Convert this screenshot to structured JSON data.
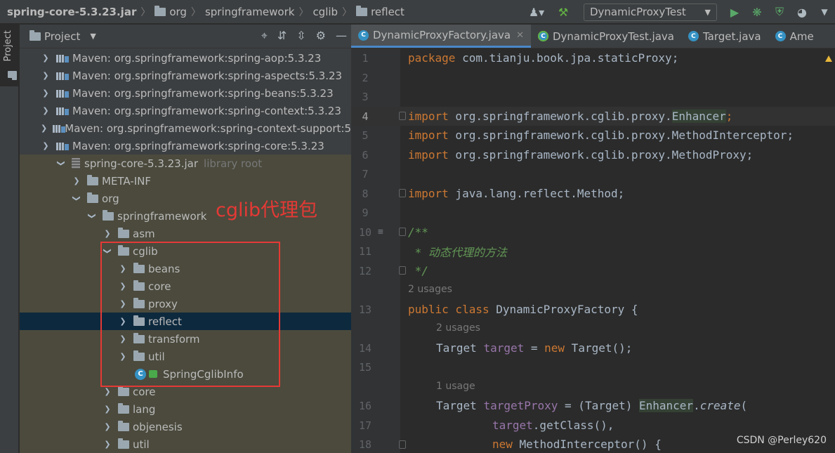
{
  "breadcrumb": {
    "items": [
      "spring-core-5.3.23.jar",
      "org",
      "springframework",
      "cglib",
      "reflect"
    ]
  },
  "toolbar": {
    "run_config": "DynamicProxyTest"
  },
  "stripe": {
    "project_label": "Project"
  },
  "project_panel": {
    "title": "Project",
    "tree": [
      {
        "label": "Maven: org.springframework:spring-aop:5.3.23",
        "type": "lib",
        "expanded": false
      },
      {
        "label": "Maven: org.springframework:spring-aspects:5.3.23",
        "type": "lib",
        "expanded": false
      },
      {
        "label": "Maven: org.springframework:spring-beans:5.3.23",
        "type": "lib",
        "expanded": false
      },
      {
        "label": "Maven: org.springframework:spring-context:5.3.23",
        "type": "lib",
        "expanded": false
      },
      {
        "label": "Maven: org.springframework:spring-context-support:5",
        "type": "lib",
        "expanded": false
      },
      {
        "label": "Maven: org.springframework:spring-core:5.3.23",
        "type": "lib",
        "expanded": true
      },
      {
        "label": "spring-core-5.3.23.jar",
        "suffix": "library root",
        "type": "jar",
        "expanded": true
      },
      {
        "label": "META-INF",
        "type": "folder",
        "expanded": false
      },
      {
        "label": "org",
        "type": "folder",
        "expanded": true
      },
      {
        "label": "springframework",
        "type": "folder",
        "expanded": true
      },
      {
        "label": "asm",
        "type": "folder",
        "expanded": false
      },
      {
        "label": "cglib",
        "type": "folder",
        "expanded": true
      },
      {
        "label": "beans",
        "type": "folder",
        "expanded": false
      },
      {
        "label": "core",
        "type": "folder",
        "expanded": false
      },
      {
        "label": "proxy",
        "type": "folder",
        "expanded": false
      },
      {
        "label": "reflect",
        "type": "folder",
        "expanded": false,
        "selected": true
      },
      {
        "label": "transform",
        "type": "folder",
        "expanded": false
      },
      {
        "label": "util",
        "type": "folder",
        "expanded": false
      },
      {
        "label": "SpringCglibInfo",
        "type": "class"
      },
      {
        "label": "core",
        "type": "folder",
        "expanded": false
      },
      {
        "label": "lang",
        "type": "folder",
        "expanded": false
      },
      {
        "label": "objenesis",
        "type": "folder",
        "expanded": false
      },
      {
        "label": "util",
        "type": "folder",
        "expanded": false
      }
    ]
  },
  "annotation": {
    "text": "cglib代理包"
  },
  "editor": {
    "tabs": [
      {
        "label": "DynamicProxyFactory.java",
        "active": true,
        "closable": true
      },
      {
        "label": "DynamicProxyTest.java",
        "active": false,
        "closable": false
      },
      {
        "label": "Target.java",
        "active": false,
        "closable": false
      },
      {
        "label": "Ame",
        "active": false,
        "closable": false
      }
    ],
    "lines": {
      "l1": {
        "no": "1",
        "kw": "package",
        "rest": " com.tianju.book.jpa.staticProxy;"
      },
      "l2": {
        "no": "2"
      },
      "l3": {
        "no": "3"
      },
      "l4": {
        "no": "4",
        "kw": "import",
        "pre": " org.springframework.cglib.proxy.",
        "cls": "Enhancer",
        "post": ";"
      },
      "l5": {
        "no": "5",
        "kw": "import",
        "rest": " org.springframework.cglib.proxy.MethodInterceptor;"
      },
      "l6": {
        "no": "6",
        "kw": "import",
        "rest": " org.springframework.cglib.proxy.MethodProxy;"
      },
      "l7": {
        "no": "7"
      },
      "l8": {
        "no": "8",
        "kw": "import",
        "rest": " java.lang.reflect.Method;"
      },
      "l9": {
        "no": "9"
      },
      "l10": {
        "no": "10",
        "cmt": "/**"
      },
      "l11": {
        "no": "11",
        "cmt": " * 动态代理的方法"
      },
      "l12": {
        "no": "12",
        "cmt": " */"
      },
      "u1": "2 usages",
      "l13": {
        "no": "13",
        "kw": "public class",
        "rest": " DynamicProxyFactory {"
      },
      "u2": "2 usages",
      "l14": {
        "no": "14",
        "t1": "Target ",
        "fld": "target",
        "t2": " = ",
        "kw": "new",
        "t3": " Target();"
      },
      "l15": {
        "no": "15"
      },
      "u3": "1 usage",
      "l16": {
        "no": "16",
        "t1": "Target ",
        "fld": "targetProxy",
        "t2": " = (Target) ",
        "cls": "Enhancer",
        "t3": ".",
        "it": "create",
        "t4": "("
      },
      "l17": {
        "no": "17",
        "fld": "target",
        "t1": ".getClass(),"
      },
      "l18": {
        "no": "18",
        "kw": "new",
        "t1": " MethodInterceptor() {"
      }
    }
  },
  "watermark": "CSDN @Perley620"
}
